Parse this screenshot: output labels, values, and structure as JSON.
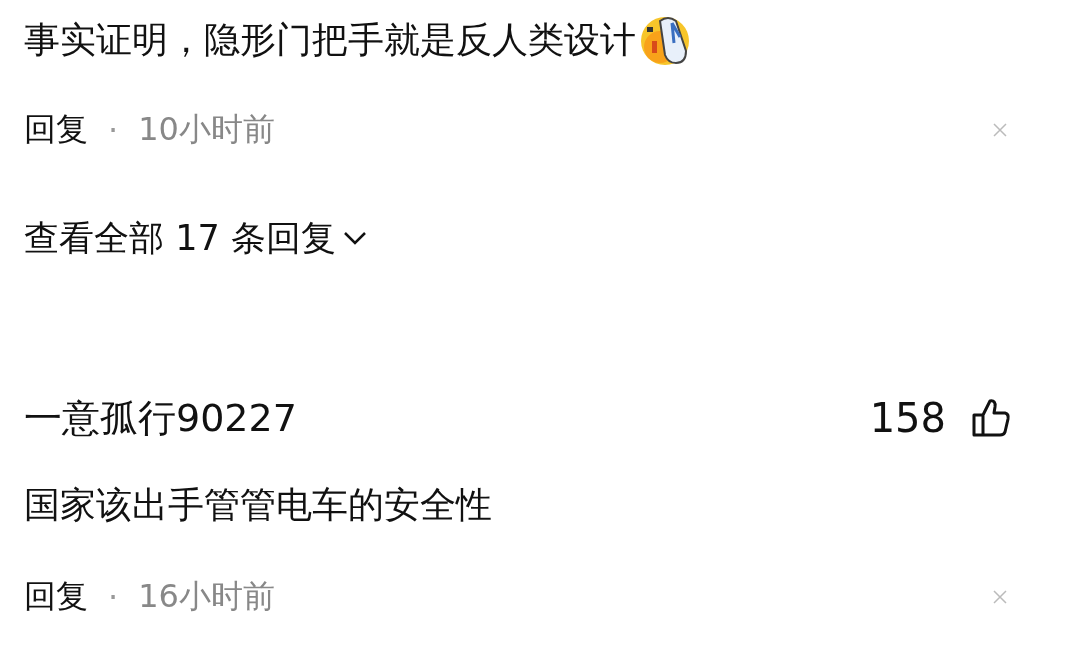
{
  "comments": [
    {
      "text": "事实证明，隐形门把手就是反人类设计",
      "trailing_emoji": true,
      "reply_label": "回复",
      "separator": "·",
      "time": "10小时前",
      "view_replies": {
        "label": "查看全部 17 条回复"
      }
    },
    {
      "username": "一意孤行90227",
      "likes": "158",
      "text": "国家该出手管管电车的安全性",
      "trailing_emoji": false,
      "reply_label": "回复",
      "separator": "·",
      "time": "16小时前"
    }
  ]
}
